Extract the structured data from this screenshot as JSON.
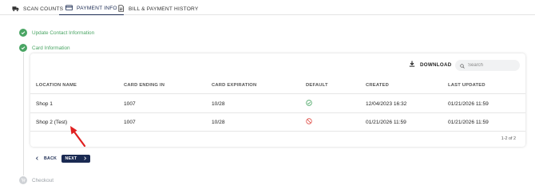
{
  "tabs": [
    {
      "label": "SCAN COUNTS",
      "icon": "truck-icon"
    },
    {
      "label": "PAYMENT INFO",
      "icon": "credit-card-icon",
      "active": true
    },
    {
      "label": "BILL & PAYMENT HISTORY",
      "icon": "document-icon"
    }
  ],
  "steps": [
    {
      "label": "Update Contact Information",
      "status": "done"
    },
    {
      "label": "Card Information",
      "status": "done"
    },
    {
      "label": "Checkout",
      "status": "pending"
    }
  ],
  "toolbar": {
    "download_label": "DOWNLOAD",
    "search_placeholder": "Search"
  },
  "table": {
    "columns": [
      "LOCATION NAME",
      "CARD ENDING IN",
      "CARD EXPIRATION",
      "DEFAULT",
      "CREATED",
      "LAST UPDATED"
    ],
    "rows": [
      {
        "location": "Shop 1",
        "card_ending": "1007",
        "expiration": "10/28",
        "default": "check-circle-icon",
        "created": "12/04/2023 16:32",
        "updated": "01/21/2026 11:59"
      },
      {
        "location": "Shop 2 (Test)",
        "card_ending": "1007",
        "expiration": "10/28",
        "default": "no-entry-icon",
        "created": "01/21/2026 11:59",
        "updated": "01/21/2026 11:59"
      }
    ],
    "pagination": "1-2 of 2"
  },
  "nav": {
    "back_label": "BACK",
    "next_label": "NEXT"
  },
  "colors": {
    "primary": "#1a2a52",
    "success": "#4aa564",
    "danger": "#e0524a",
    "annotation_arrow": "#e02020"
  }
}
